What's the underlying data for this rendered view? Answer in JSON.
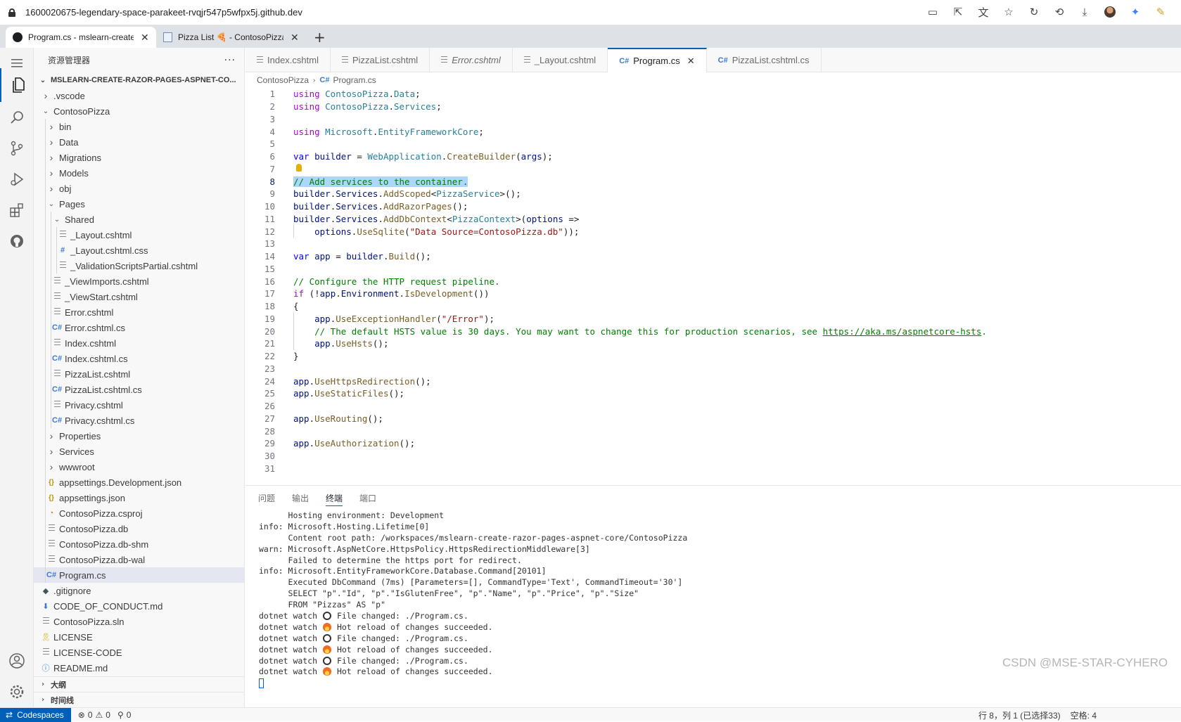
{
  "browser": {
    "url": "1600020675-legendary-space-parakeet-rvqjr547p5wfpx5j.github.dev",
    "tabs": [
      {
        "label": "Program.cs - mslearn-create-ra"
      },
      {
        "label": "Pizza List 🍕 - ContosoPizza"
      }
    ]
  },
  "sidebar": {
    "title": "资源管理器",
    "more": "···",
    "root": "MSLEARN-CREATE-RAZOR-PAGES-ASPNET-CO...",
    "tree": [
      {
        "label": ".vscode",
        "depth": 1,
        "kind": "folder",
        "open": false
      },
      {
        "label": "ContosoPizza",
        "depth": 1,
        "kind": "folder",
        "open": true
      },
      {
        "label": "bin",
        "depth": 2,
        "kind": "folder",
        "open": false
      },
      {
        "label": "Data",
        "depth": 2,
        "kind": "folder",
        "open": false
      },
      {
        "label": "Migrations",
        "depth": 2,
        "kind": "folder",
        "open": false
      },
      {
        "label": "Models",
        "depth": 2,
        "kind": "folder",
        "open": false
      },
      {
        "label": "obj",
        "depth": 2,
        "kind": "folder",
        "open": false
      },
      {
        "label": "Pages",
        "depth": 2,
        "kind": "folder",
        "open": true
      },
      {
        "label": "Shared",
        "depth": 3,
        "kind": "folder",
        "open": true
      },
      {
        "label": "_Layout.cshtml",
        "depth": 4,
        "kind": "lines"
      },
      {
        "label": "_Layout.cshtml.css",
        "depth": 4,
        "kind": "hash"
      },
      {
        "label": "_ValidationScriptsPartial.cshtml",
        "depth": 4,
        "kind": "lines"
      },
      {
        "label": "_ViewImports.cshtml",
        "depth": 3,
        "kind": "lines"
      },
      {
        "label": "_ViewStart.cshtml",
        "depth": 3,
        "kind": "lines"
      },
      {
        "label": "Error.cshtml",
        "depth": 3,
        "kind": "lines"
      },
      {
        "label": "Error.cshtml.cs",
        "depth": 3,
        "kind": "cs"
      },
      {
        "label": "Index.cshtml",
        "depth": 3,
        "kind": "lines"
      },
      {
        "label": "Index.cshtml.cs",
        "depth": 3,
        "kind": "cs"
      },
      {
        "label": "PizzaList.cshtml",
        "depth": 3,
        "kind": "lines"
      },
      {
        "label": "PizzaList.cshtml.cs",
        "depth": 3,
        "kind": "cs"
      },
      {
        "label": "Privacy.cshtml",
        "depth": 3,
        "kind": "lines"
      },
      {
        "label": "Privacy.cshtml.cs",
        "depth": 3,
        "kind": "cs"
      },
      {
        "label": "Properties",
        "depth": 2,
        "kind": "folder",
        "open": false
      },
      {
        "label": "Services",
        "depth": 2,
        "kind": "folder",
        "open": false
      },
      {
        "label": "wwwroot",
        "depth": 2,
        "kind": "folder",
        "open": false
      },
      {
        "label": "appsettings.Development.json",
        "depth": 2,
        "kind": "json"
      },
      {
        "label": "appsettings.json",
        "depth": 2,
        "kind": "json"
      },
      {
        "label": "ContosoPizza.csproj",
        "depth": 2,
        "kind": "rss"
      },
      {
        "label": "ContosoPizza.db",
        "depth": 2,
        "kind": "lines"
      },
      {
        "label": "ContosoPizza.db-shm",
        "depth": 2,
        "kind": "lines"
      },
      {
        "label": "ContosoPizza.db-wal",
        "depth": 2,
        "kind": "lines"
      },
      {
        "label": "Program.cs",
        "depth": 2,
        "kind": "cs",
        "selected": true
      },
      {
        "label": ".gitignore",
        "depth": 1,
        "kind": "git"
      },
      {
        "label": "CODE_OF_CONDUCT.md",
        "depth": 1,
        "kind": "md"
      },
      {
        "label": "ContosoPizza.sln",
        "depth": 1,
        "kind": "lines"
      },
      {
        "label": "LICENSE",
        "depth": 1,
        "kind": "lic"
      },
      {
        "label": "LICENSE-CODE",
        "depth": 1,
        "kind": "lines"
      },
      {
        "label": "README.md",
        "depth": 1,
        "kind": "info"
      }
    ],
    "sections": [
      "大纲",
      "时间线"
    ]
  },
  "editor": {
    "tabs": [
      {
        "label": "Index.cshtml",
        "icon": "lines"
      },
      {
        "label": "PizzaList.cshtml",
        "icon": "lines"
      },
      {
        "label": "Error.cshtml",
        "icon": "lines",
        "italic": true
      },
      {
        "label": "_Layout.cshtml",
        "icon": "lines"
      },
      {
        "label": "Program.cs",
        "icon": "cs",
        "active": true
      },
      {
        "label": "PizzaList.cshtml.cs",
        "icon": "cs"
      }
    ],
    "breadcrumb": [
      "ContosoPizza",
      "Program.cs"
    ],
    "current_line": 8,
    "lines": [
      [
        [
          "kw2",
          "using "
        ],
        [
          "ns",
          "ContosoPizza"
        ],
        [
          "",
          "."
        ],
        [
          "ns",
          "Data"
        ],
        [
          "",
          ";"
        ]
      ],
      [
        [
          "kw2",
          "using "
        ],
        [
          "ns",
          "ContosoPizza"
        ],
        [
          "",
          "."
        ],
        [
          "ns",
          "Services"
        ],
        [
          "",
          ";"
        ]
      ],
      [],
      [
        [
          "kw2",
          "using "
        ],
        [
          "ns",
          "Microsoft"
        ],
        [
          "",
          "."
        ],
        [
          "ns",
          "EntityFrameworkCore"
        ],
        [
          "",
          ";"
        ]
      ],
      [],
      [
        [
          "kw",
          "var "
        ],
        [
          "var",
          "builder"
        ],
        [
          "",
          " = "
        ],
        [
          "ns",
          "WebApplication"
        ],
        [
          "",
          "."
        ],
        [
          "fn",
          "CreateBuilder"
        ],
        [
          "",
          "("
        ],
        [
          "var",
          "args"
        ],
        [
          "",
          ");"
        ]
      ],
      [],
      [
        [
          "cm hl",
          "// Add services to the container."
        ]
      ],
      [
        [
          "var",
          "builder"
        ],
        [
          "",
          "."
        ],
        [
          "var",
          "Services"
        ],
        [
          "",
          "."
        ],
        [
          "fn",
          "AddScoped"
        ],
        [
          "",
          "<"
        ],
        [
          "ns",
          "PizzaService"
        ],
        [
          "",
          ">();"
        ]
      ],
      [
        [
          "var",
          "builder"
        ],
        [
          "",
          "."
        ],
        [
          "var",
          "Services"
        ],
        [
          "",
          "."
        ],
        [
          "fn",
          "AddRazorPages"
        ],
        [
          "",
          "();"
        ]
      ],
      [
        [
          "var",
          "builder"
        ],
        [
          "",
          "."
        ],
        [
          "var",
          "Services"
        ],
        [
          "",
          "."
        ],
        [
          "fn",
          "AddDbContext"
        ],
        [
          "",
          "<"
        ],
        [
          "ns",
          "PizzaContext"
        ],
        [
          "",
          ">("
        ],
        [
          "var",
          "options"
        ],
        [
          "",
          " =>"
        ]
      ],
      [
        [
          "",
          "    "
        ],
        [
          "var",
          "options"
        ],
        [
          "",
          "."
        ],
        [
          "fn",
          "UseSqlite"
        ],
        [
          "",
          "("
        ],
        [
          "str",
          "\"Data Source=ContosoPizza.db\""
        ],
        [
          "",
          "));"
        ]
      ],
      [],
      [
        [
          "kw",
          "var "
        ],
        [
          "var",
          "app"
        ],
        [
          "",
          " = "
        ],
        [
          "var",
          "builder"
        ],
        [
          "",
          "."
        ],
        [
          "fn",
          "Build"
        ],
        [
          "",
          "();"
        ]
      ],
      [],
      [
        [
          "cm",
          "// Configure the HTTP request pipeline."
        ]
      ],
      [
        [
          "kw2",
          "if "
        ],
        [
          "",
          "(!"
        ],
        [
          "var",
          "app"
        ],
        [
          "",
          "."
        ],
        [
          "var",
          "Environment"
        ],
        [
          "",
          "."
        ],
        [
          "fn",
          "IsDevelopment"
        ],
        [
          "",
          "())"
        ]
      ],
      [
        [
          "",
          "{"
        ]
      ],
      [
        [
          "",
          "    "
        ],
        [
          "var",
          "app"
        ],
        [
          "",
          "."
        ],
        [
          "fn",
          "UseExceptionHandler"
        ],
        [
          "",
          "("
        ],
        [
          "str",
          "\"/Error\""
        ],
        [
          "",
          ");"
        ]
      ],
      [
        [
          "",
          "    "
        ],
        [
          "cm",
          "// The default HSTS value is 30 days. You may want to change this for production scenarios, see "
        ],
        [
          "link",
          "https://aka.ms/aspnetcore-hsts"
        ],
        [
          "cm",
          "."
        ]
      ],
      [
        [
          "",
          "    "
        ],
        [
          "var",
          "app"
        ],
        [
          "",
          "."
        ],
        [
          "fn",
          "UseHsts"
        ],
        [
          "",
          "();"
        ]
      ],
      [
        [
          "",
          "}"
        ]
      ],
      [],
      [
        [
          "var",
          "app"
        ],
        [
          "",
          "."
        ],
        [
          "fn",
          "UseHttpsRedirection"
        ],
        [
          "",
          "();"
        ]
      ],
      [
        [
          "var",
          "app"
        ],
        [
          "",
          "."
        ],
        [
          "fn",
          "UseStaticFiles"
        ],
        [
          "",
          "();"
        ]
      ],
      [],
      [
        [
          "var",
          "app"
        ],
        [
          "",
          "."
        ],
        [
          "fn",
          "UseRouting"
        ],
        [
          "",
          "();"
        ]
      ],
      [],
      [
        [
          "var",
          "app"
        ],
        [
          "",
          "."
        ],
        [
          "fn",
          "UseAuthorization"
        ],
        [
          "",
          "();"
        ]
      ],
      [],
      []
    ]
  },
  "panel": {
    "tabs": [
      "问题",
      "输出",
      "终端",
      "端口"
    ],
    "active_tab": "终端",
    "terminal": [
      {
        "text": "      Hosting environment: Development"
      },
      {
        "text": "info: Microsoft.Hosting.Lifetime[0]"
      },
      {
        "text": "      Content root path: /workspaces/mslearn-create-razor-pages-aspnet-core/ContosoPizza"
      },
      {
        "text": "warn: Microsoft.AspNetCore.HttpsPolicy.HttpsRedirectionMiddleware[3]"
      },
      {
        "text": "      Failed to determine the https port for redirect."
      },
      {
        "text": "info: Microsoft.EntityFrameworkCore.Database.Command[20101]"
      },
      {
        "text": "      Executed DbCommand (7ms) [Parameters=[], CommandType='Text', CommandTimeout='30']"
      },
      {
        "text": "      SELECT \"p\".\"Id\", \"p\".\"IsGlutenFree\", \"p\".\"Name\", \"p\".\"Price\", \"p\".\"Size\""
      },
      {
        "text": "      FROM \"Pizzas\" AS \"p\""
      },
      {
        "prefix": "dotnet watch ",
        "emoji": "watch",
        "text": " File changed: ./Program.cs."
      },
      {
        "prefix": "dotnet watch ",
        "emoji": "fire",
        "text": " Hot reload of changes succeeded."
      },
      {
        "prefix": "dotnet watch ",
        "emoji": "watch",
        "text": " File changed: ./Program.cs."
      },
      {
        "prefix": "dotnet watch ",
        "emoji": "fire",
        "text": " Hot reload of changes succeeded."
      },
      {
        "prefix": "dotnet watch ",
        "emoji": "watch",
        "text": " File changed: ./Program.cs."
      },
      {
        "prefix": "dotnet watch ",
        "emoji": "fire",
        "text": " Hot reload of changes succeeded."
      }
    ]
  },
  "statusbar": {
    "remote": "Codespaces",
    "errors": "0",
    "warnings": "0",
    "ports": "0",
    "position": "行 8，列 1 (已选择33)",
    "spaces": "空格: 4"
  },
  "watermark": "CSDN @MSE-STAR-CYHERO"
}
